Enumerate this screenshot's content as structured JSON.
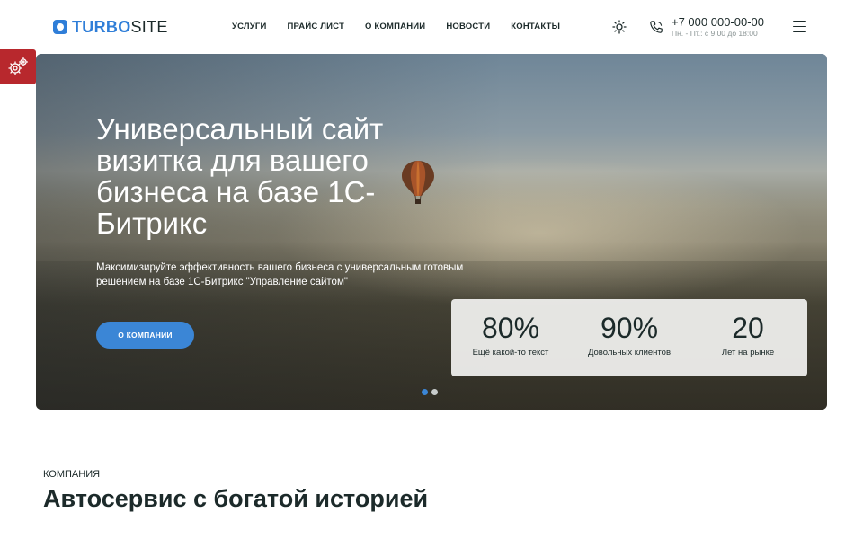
{
  "header": {
    "logo": {
      "part1": "TURBO",
      "part2": "SITE"
    },
    "nav": [
      "Услуги",
      "Прайс лист",
      "О компании",
      "Новости",
      "Контакты"
    ],
    "phone": {
      "number": "+7 000 000-00-00",
      "hours": "Пн. - Пт.: с 9:00 до 18:00"
    },
    "icons": {
      "theme": "sun-icon",
      "phone": "phone-icon",
      "menu": "burger-menu-icon"
    }
  },
  "settings_tab": {
    "icon": "gears-icon",
    "color": "#b8282d"
  },
  "hero": {
    "title": "Универсальный сайт визитка для вашего бизнеса на базе 1С-Битрикс",
    "subtitle": "Максимизируйте эффективность вашего бизнеса с универсальным готовым решением на базе 1С-Битрикс \"Управление сайтом\"",
    "button": "О компании",
    "stats": [
      {
        "value": "80%",
        "label": "Ещё какой-то текст"
      },
      {
        "value": "90%",
        "label": "Довольных клиентов"
      },
      {
        "value": "20",
        "label": "Лет на рынке"
      }
    ],
    "slider": {
      "slides": 2,
      "active": 1
    }
  },
  "company": {
    "eyebrow": "Компания",
    "title": "Автосервис с богатой историей"
  },
  "colors": {
    "accent": "#3b86d6",
    "logo": "#2f7ed8",
    "text": "#1c2a2a"
  }
}
